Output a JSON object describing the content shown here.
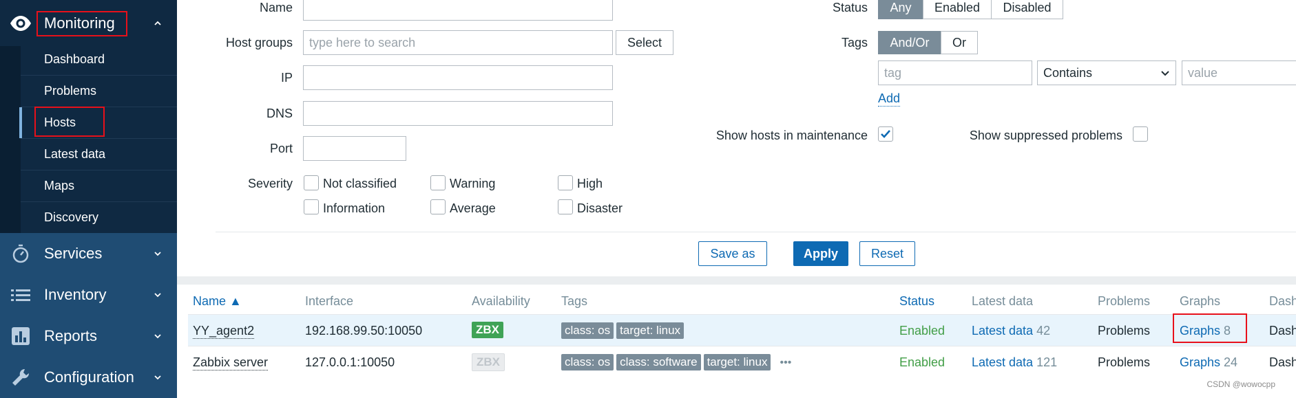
{
  "sidebar": {
    "monitoring": "Monitoring",
    "items": [
      "Dashboard",
      "Problems",
      "Hosts",
      "Latest data",
      "Maps",
      "Discovery"
    ],
    "services": "Services",
    "inventory": "Inventory",
    "reports": "Reports",
    "configuration": "Configuration"
  },
  "filter": {
    "name_label": "Name",
    "hostgroups_label": "Host groups",
    "hostgroups_placeholder": "type here to search",
    "select_button": "Select",
    "ip_label": "IP",
    "dns_label": "DNS",
    "port_label": "Port",
    "severity_label": "Severity",
    "severities": [
      "Not classified",
      "Warning",
      "High",
      "Information",
      "Average",
      "Disaster"
    ],
    "status_label": "Status",
    "status_options": [
      "Any",
      "Enabled",
      "Disabled"
    ],
    "tags_label": "Tags",
    "tags_options": [
      "And/Or",
      "Or"
    ],
    "tag_placeholder": "tag",
    "operator": "Contains",
    "value_placeholder": "value",
    "add_link": "Add",
    "show_maintenance_label": "Show hosts in maintenance",
    "show_maintenance_checked": true,
    "show_suppressed_label": "Show suppressed problems",
    "show_suppressed_checked": false,
    "save_as": "Save as",
    "apply": "Apply",
    "reset": "Reset"
  },
  "table": {
    "headers": [
      "Name ▲",
      "Interface",
      "Availability",
      "Tags",
      "Status",
      "Latest data",
      "Problems",
      "Graphs",
      "Dash"
    ],
    "rows": [
      {
        "name": "YY_agent2",
        "interface": "192.168.99.50:10050",
        "availability": "ZBX",
        "tags": [
          "class: os",
          "target: linux"
        ],
        "status": "Enabled",
        "latest_label": "Latest data",
        "latest_count": "42",
        "problems": "Problems",
        "graphs_label": "Graphs",
        "graphs_count": "8",
        "dash": "Dash"
      },
      {
        "name": "Zabbix server",
        "interface": "127.0.0.1:10050",
        "availability": "ZBX",
        "tags": [
          "class: os",
          "class: software",
          "target: linux"
        ],
        "more": "•••",
        "status": "Enabled",
        "latest_label": "Latest data",
        "latest_count": "121",
        "problems": "Problems",
        "graphs_label": "Graphs",
        "graphs_count": "24",
        "dash": "Dash"
      }
    ]
  },
  "watermark": "CSDN @wowocpp",
  "colors": {
    "sidebar": "#1f4c73",
    "sidebar_dark": "#0f2942",
    "accent": "#0e6ab3",
    "enabled": "#429e47",
    "zbx_available": "#3fa356",
    "highlight": "#e8101a"
  }
}
